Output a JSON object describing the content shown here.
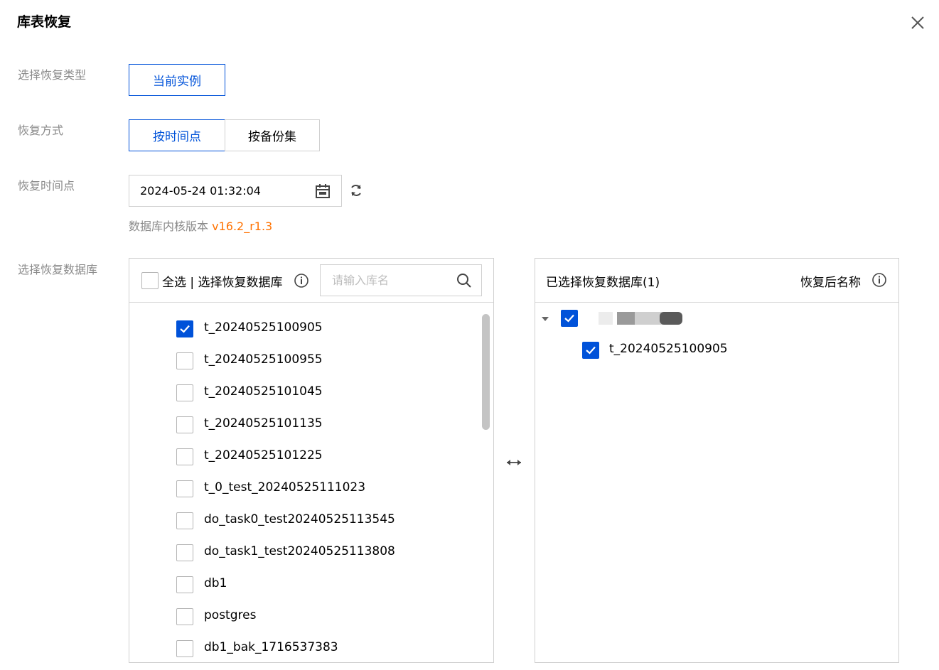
{
  "dialog": {
    "title": "库表恢复",
    "close_icon": "close-icon"
  },
  "restore_type": {
    "label": "选择恢复类型",
    "options": [
      "当前实例"
    ],
    "selected": "当前实例"
  },
  "restore_method": {
    "label": "恢复方式",
    "options": [
      "按时间点",
      "按备份集"
    ],
    "selected": "按时间点"
  },
  "restore_time": {
    "label": "恢复时间点",
    "value": "2024-05-24 01:32:04",
    "calendar_icon": "calendar-icon",
    "refresh_icon": "refresh-icon"
  },
  "kernel": {
    "prefix": "数据库内核版本",
    "version": "v16.2_r1.3",
    "version_color": "#ff7200"
  },
  "select_db": {
    "label": "选择恢复数据库"
  },
  "source_panel": {
    "select_all_label": "全选 | 选择恢复数据库",
    "search_placeholder": "请输入库名",
    "items": [
      {
        "name": "t_20240525100905",
        "checked": true
      },
      {
        "name": "t_20240525100955",
        "checked": false
      },
      {
        "name": "t_20240525101045",
        "checked": false
      },
      {
        "name": "t_20240525101135",
        "checked": false
      },
      {
        "name": "t_20240525101225",
        "checked": false
      },
      {
        "name": "t_0_test_20240525111023",
        "checked": false
      },
      {
        "name": "do_task0_test20240525113545",
        "checked": false
      },
      {
        "name": "do_task1_test20240525113808",
        "checked": false
      },
      {
        "name": "db1",
        "checked": false
      },
      {
        "name": "postgres",
        "checked": false
      },
      {
        "name": "db1_bak_1716537383",
        "checked": false
      }
    ]
  },
  "target_panel": {
    "title": "已选择恢复数据库(1)",
    "rename_label": "恢复后名称",
    "tree_child": "t_20240525100905"
  },
  "colors": {
    "primary": "#0052d9",
    "border": "#d0d0d0",
    "label": "#8a8a8a"
  }
}
